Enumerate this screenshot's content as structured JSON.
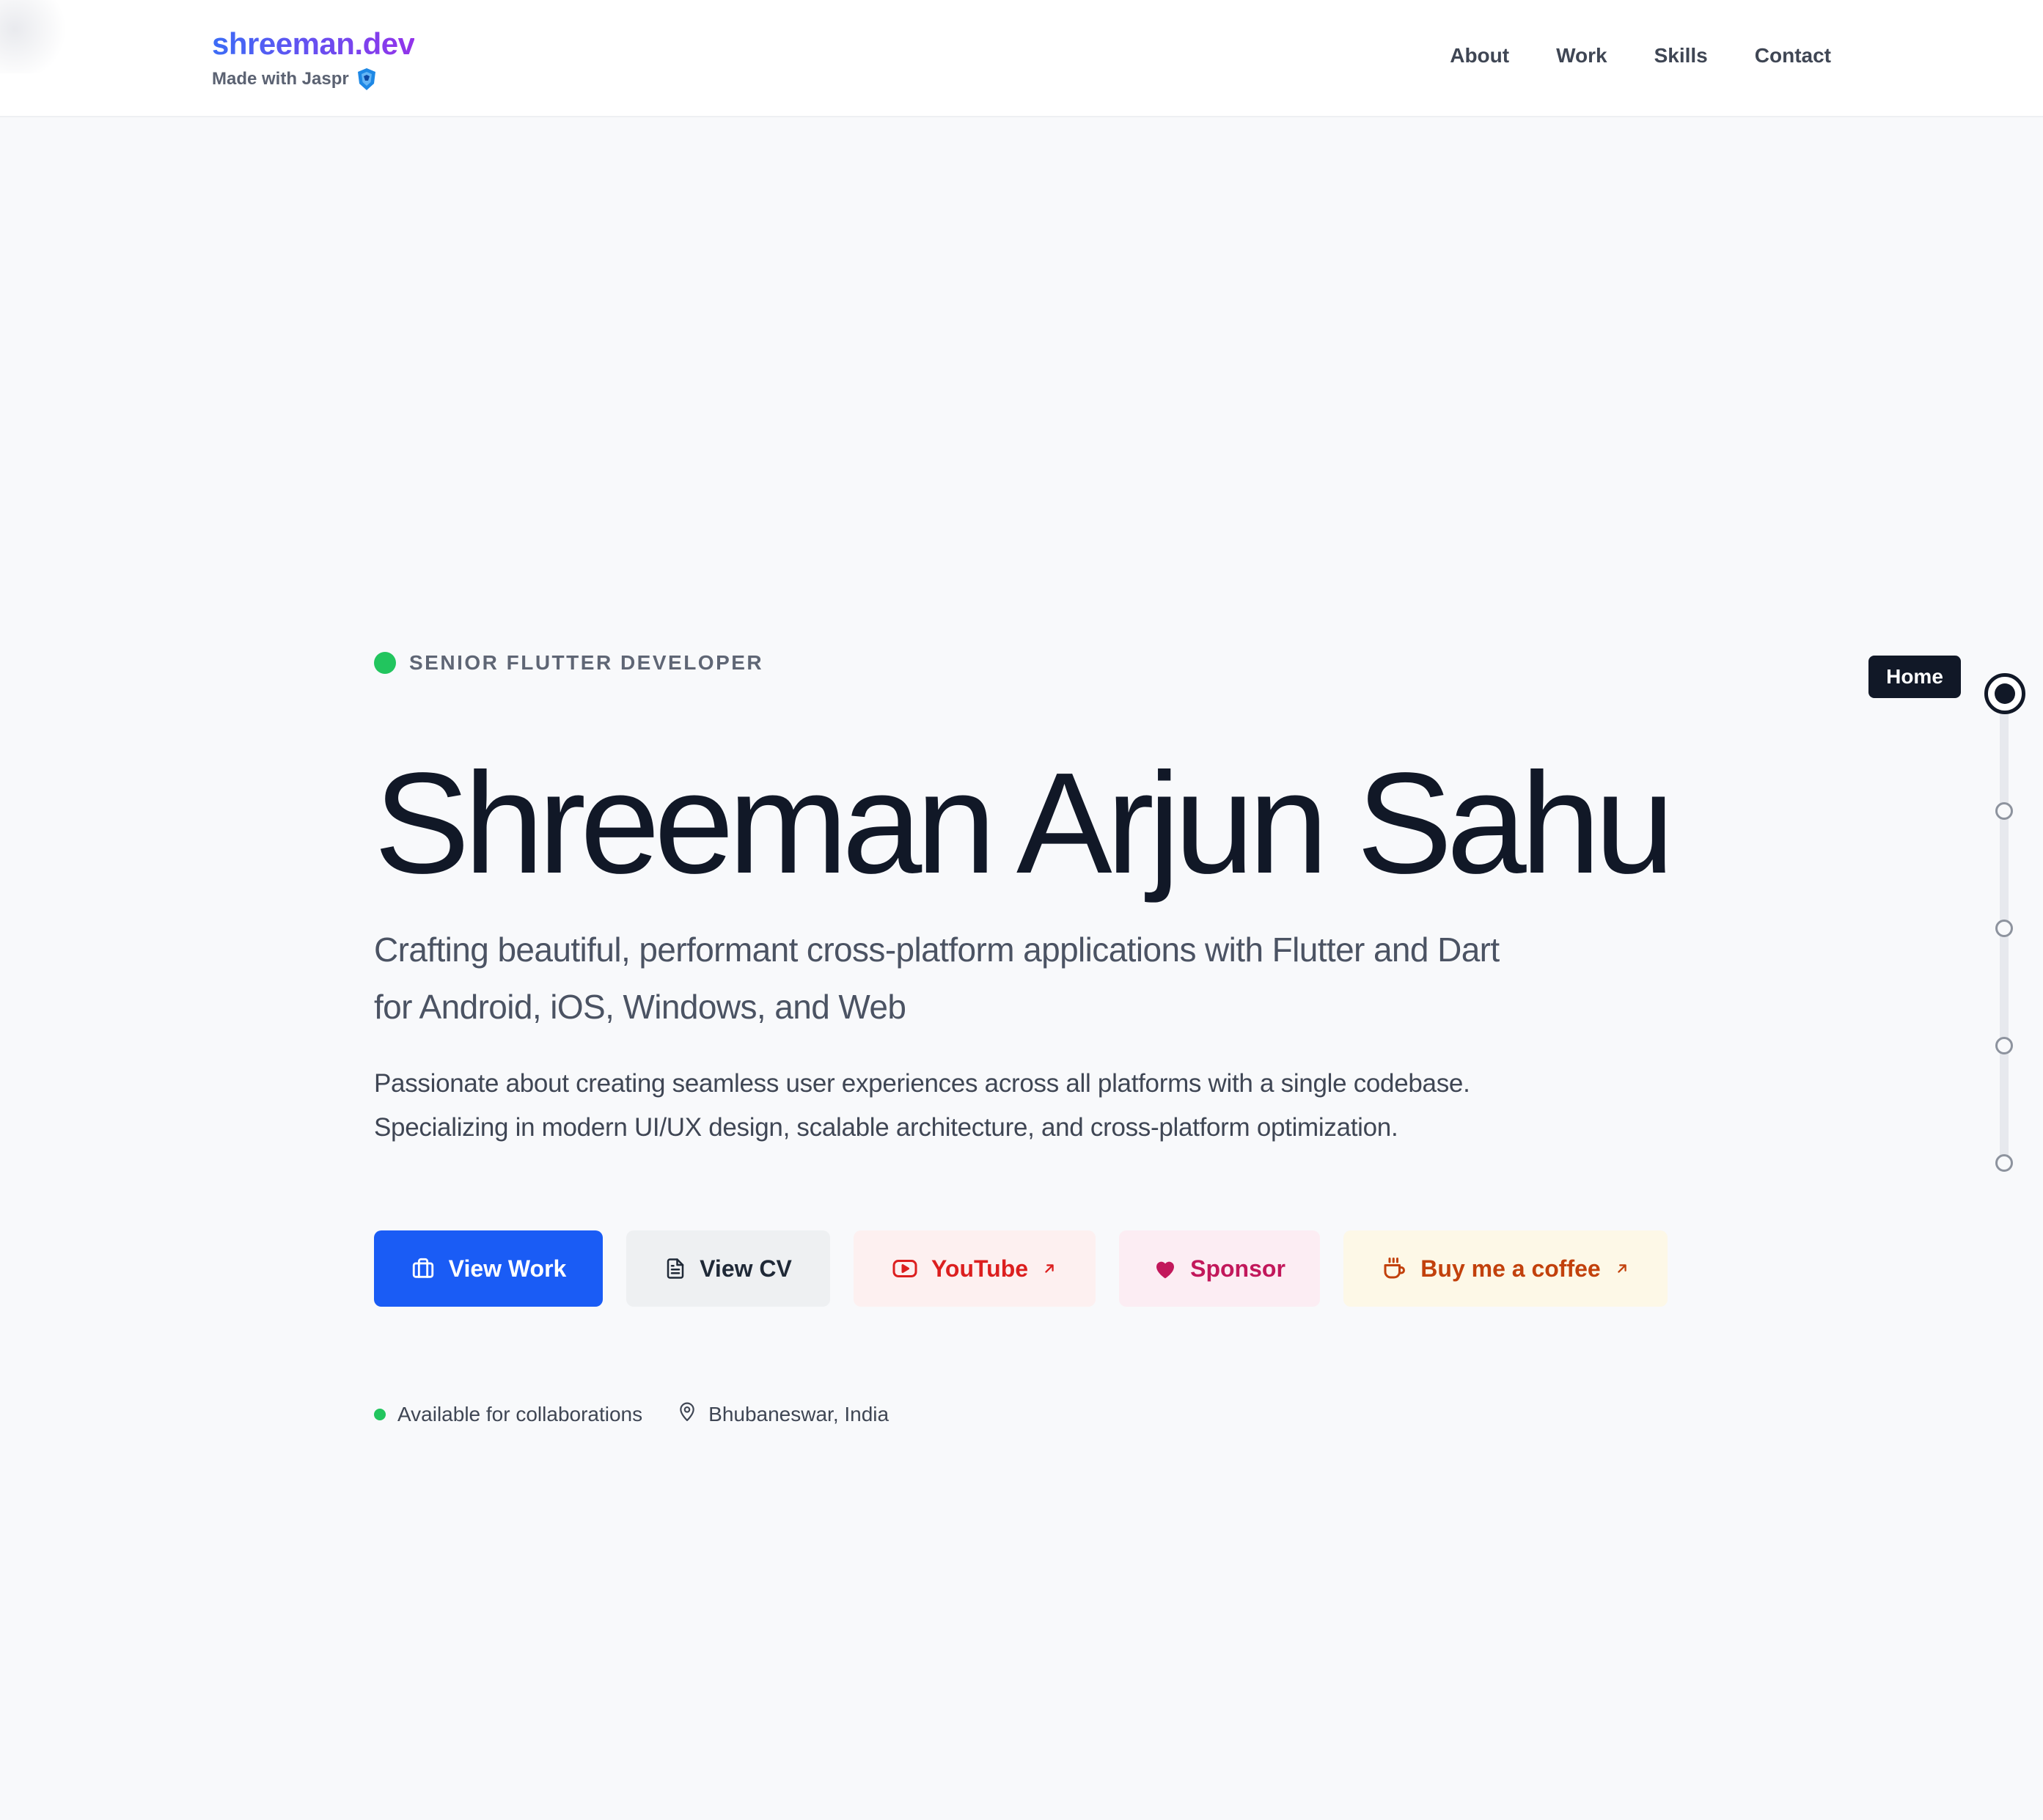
{
  "header": {
    "brand": "shreeman.dev",
    "made_with": "Made with Jaspr",
    "nav": [
      {
        "label": "About"
      },
      {
        "label": "Work"
      },
      {
        "label": "Skills"
      },
      {
        "label": "Contact"
      }
    ]
  },
  "hero": {
    "eyebrow": "SENIOR FLUTTER DEVELOPER",
    "name": "Shreeman Arjun Sahu",
    "subtitle": "Crafting beautiful, performant cross-platform applications with Flutter and Dart for Android, iOS, Windows, and Web",
    "description": "Passionate about creating seamless user experiences across all platforms with a single codebase. Specializing in modern UI/UX design, scalable architecture, and cross-platform optimization."
  },
  "actions": {
    "view_work": "View Work",
    "view_cv": "View CV",
    "youtube": "YouTube",
    "sponsor": "Sponsor",
    "coffee": "Buy me a coffee"
  },
  "meta": {
    "availability": "Available for collaborations",
    "location": "Bhubaneswar, India"
  },
  "side_nav": {
    "active_label": "Home",
    "section_count": 5,
    "active_index": 0
  },
  "colors": {
    "primary": "#1a5cf5",
    "status_green": "#22c55e",
    "youtube_red": "#dc1f1f",
    "sponsor_pink": "#c2185b",
    "coffee_orange": "#c2410c",
    "brand_gradient_start": "#3b6cf6",
    "brand_gradient_end": "#9333ea"
  },
  "icons": {
    "view_work": "briefcase-icon",
    "view_cv": "document-icon",
    "youtube": "youtube-icon",
    "external": "arrow-up-right-icon",
    "sponsor": "heart-icon",
    "coffee": "coffee-cup-icon",
    "location": "map-pin-icon",
    "made_with": "jaspr-logo-icon"
  }
}
